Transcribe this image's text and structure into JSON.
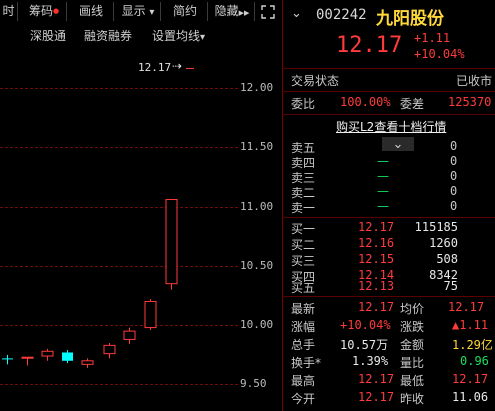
{
  "toolbar": {
    "items": [
      "时",
      "筹码",
      "画线",
      "显示",
      "简约",
      "隐藏"
    ],
    "chip_dot": "●",
    "display_caret": "▾",
    "hide_arrows": "▶▶",
    "expand_icon": "⛶"
  },
  "subtabs": [
    "深股通",
    "融资融券",
    "设置均线"
  ],
  "subtab_caret": "▾",
  "chart": {
    "yaxis": [
      "12.00",
      "11.50",
      "11.00",
      "10.50",
      "10.00",
      "9.50"
    ],
    "price_marker": "12.17",
    "arrow": "⇢"
  },
  "chart_data": {
    "type": "candlestick",
    "yaxis_ticks": [
      12.0,
      11.5,
      11.0,
      10.5,
      10.0,
      9.5
    ],
    "ylim": [
      9.38,
      12.36
    ],
    "candles": [
      {
        "open": 9.72,
        "close": 9.72,
        "high": 9.75,
        "low": 9.67,
        "color": "cyan"
      },
      {
        "open": 9.73,
        "close": 9.73,
        "high": 9.73,
        "low": 9.66,
        "color": "red"
      },
      {
        "open": 9.74,
        "close": 9.78,
        "high": 9.8,
        "low": 9.7,
        "color": "red"
      },
      {
        "open": 9.77,
        "close": 9.7,
        "high": 9.79,
        "low": 9.68,
        "color": "cyan"
      },
      {
        "open": 9.67,
        "close": 9.7,
        "high": 9.72,
        "low": 9.64,
        "color": "red"
      },
      {
        "open": 9.76,
        "close": 9.83,
        "high": 9.85,
        "low": 9.72,
        "color": "red"
      },
      {
        "open": 9.88,
        "close": 9.95,
        "high": 9.98,
        "low": 9.84,
        "color": "red"
      },
      {
        "open": 9.98,
        "close": 10.2,
        "high": 10.22,
        "low": 9.96,
        "color": "red"
      },
      {
        "open": 10.35,
        "close": 11.06,
        "high": 11.06,
        "low": 10.3,
        "color": "red"
      }
    ],
    "last_price_marker": 12.17
  },
  "header": {
    "code": "002242",
    "name": "九阳股份",
    "price": "12.17",
    "change": "+1.11",
    "change_pct": "+10.04%"
  },
  "status": {
    "label": "交易状态",
    "value": "已收市"
  },
  "ratio": {
    "label1": "委比",
    "value1": "100.00%",
    "label2": "委差",
    "value2": "125370"
  },
  "l2_link": "购买L2查看十档行情",
  "collapse_icon": "⌄",
  "sells": [
    {
      "label": "卖五",
      "price": "",
      "vol": "0"
    },
    {
      "label": "卖四",
      "price": "—",
      "vol": "0"
    },
    {
      "label": "卖三",
      "price": "—",
      "vol": "0"
    },
    {
      "label": "卖二",
      "price": "—",
      "vol": "0"
    },
    {
      "label": "卖一",
      "price": "—",
      "vol": "0"
    }
  ],
  "buys": [
    {
      "label": "买一",
      "price": "12.17",
      "vol": "115185"
    },
    {
      "label": "买二",
      "price": "12.16",
      "vol": "1260"
    },
    {
      "label": "买三",
      "price": "12.15",
      "vol": "508"
    },
    {
      "label": "买四",
      "price": "12.14",
      "vol": "8342"
    },
    {
      "label": "买五",
      "price": "12.13",
      "vol": "75"
    }
  ],
  "stats": [
    {
      "l1": "最新",
      "v1": "12.17",
      "c1": "red",
      "l2": "均价",
      "v2": "12.17",
      "c2": "red"
    },
    {
      "l1": "涨幅",
      "v1": "+10.04%",
      "c1": "red",
      "l2": "涨跌",
      "v2": "▲1.11",
      "c2": "red"
    },
    {
      "l1": "总手",
      "v1": "10.57万",
      "c1": "white",
      "l2": "金额",
      "v2": "1.29亿",
      "c2": "yellow"
    },
    {
      "l1": "换手*",
      "v1": "1.39%",
      "c1": "white",
      "l2": "量比",
      "v2": "0.96",
      "c2": "green"
    },
    {
      "l1": "最高",
      "v1": "12.17",
      "c1": "red",
      "l2": "最低",
      "v2": "12.17",
      "c2": "red"
    },
    {
      "l1": "今开",
      "v1": "12.17",
      "c1": "red",
      "l2": "昨收",
      "v2": "11.06",
      "c2": "white"
    }
  ],
  "colors": {
    "up": "#ff3b3b",
    "down_cyan": "#00ffff",
    "green": "#19e05a",
    "grid": "#6e0b0b"
  }
}
